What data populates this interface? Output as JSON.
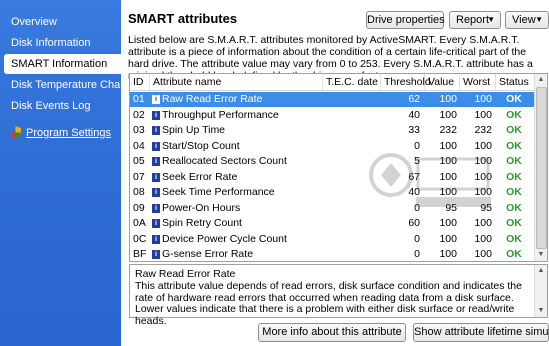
{
  "sidebar": {
    "items": [
      {
        "label": "Overview"
      },
      {
        "label": "Disk Information"
      },
      {
        "label": "SMART Information"
      },
      {
        "label": "Disk Temperature Chart"
      },
      {
        "label": "Disk Events Log"
      }
    ],
    "settings_label": "Program Settings",
    "settings_icon": "shield-icon"
  },
  "main": {
    "title": "SMART attributes",
    "buttons": {
      "drive_properties": "Drive properties",
      "report": "Report",
      "view": "View"
    },
    "description": "Listed below are S.M.A.R.T. attributes monitored by ActiveSMART. Every S.M.A.R.T. attribute is a piece of information about the condition of a certain life-critical part of the hard drive. The attribute value may vary from 0 to 253. Every S.M.A.R.T. attribute has a minimal threshold level, defined by the drive manufacturer."
  },
  "table": {
    "columns": [
      "ID",
      "Attribute name",
      "T.E.C. date",
      "Threshold",
      "Value",
      "Worst",
      "Status"
    ],
    "rows": [
      {
        "id": "01",
        "name": "Raw Read Error Rate",
        "tec": "",
        "threshold": "62",
        "value": "100",
        "worst": "100",
        "status": "OK"
      },
      {
        "id": "02",
        "name": "Throughput Performance",
        "tec": "",
        "threshold": "40",
        "value": "100",
        "worst": "100",
        "status": "OK"
      },
      {
        "id": "03",
        "name": "Spin Up Time",
        "tec": "",
        "threshold": "33",
        "value": "232",
        "worst": "232",
        "status": "OK"
      },
      {
        "id": "04",
        "name": "Start/Stop Count",
        "tec": "",
        "threshold": "0",
        "value": "100",
        "worst": "100",
        "status": "OK"
      },
      {
        "id": "05",
        "name": "Reallocated Sectors Count",
        "tec": "",
        "threshold": "5",
        "value": "100",
        "worst": "100",
        "status": "OK"
      },
      {
        "id": "07",
        "name": "Seek Error Rate",
        "tec": "",
        "threshold": "67",
        "value": "100",
        "worst": "100",
        "status": "OK"
      },
      {
        "id": "08",
        "name": "Seek Time Performance",
        "tec": "",
        "threshold": "40",
        "value": "100",
        "worst": "100",
        "status": "OK"
      },
      {
        "id": "09",
        "name": "Power-On Hours",
        "tec": "",
        "threshold": "0",
        "value": "95",
        "worst": "95",
        "status": "OK"
      },
      {
        "id": "0A",
        "name": "Spin Retry Count",
        "tec": "",
        "threshold": "60",
        "value": "100",
        "worst": "100",
        "status": "OK"
      },
      {
        "id": "0C",
        "name": "Device Power Cycle Count",
        "tec": "",
        "threshold": "0",
        "value": "100",
        "worst": "100",
        "status": "OK"
      },
      {
        "id": "BF",
        "name": "G-sense Error Rate",
        "tec": "",
        "threshold": "0",
        "value": "100",
        "worst": "100",
        "status": "OK"
      }
    ],
    "selected_index": 0
  },
  "details": {
    "title": "Raw Read Error Rate",
    "text": "This attribute value depends of read errors, disk surface condition and indicates the rate of hardware read errors that occurred when reading data from a disk surface. Lower values indicate that there is a problem with either disk surface or read/write heads."
  },
  "footer": {
    "more_info": "More info about this attribute",
    "lifetime": "Show attribute lifetime simulation"
  },
  "colors": {
    "sidebar": "#2f6fd6",
    "selected_row": "#3a8ee8",
    "status_ok": "#2e9a2e"
  }
}
